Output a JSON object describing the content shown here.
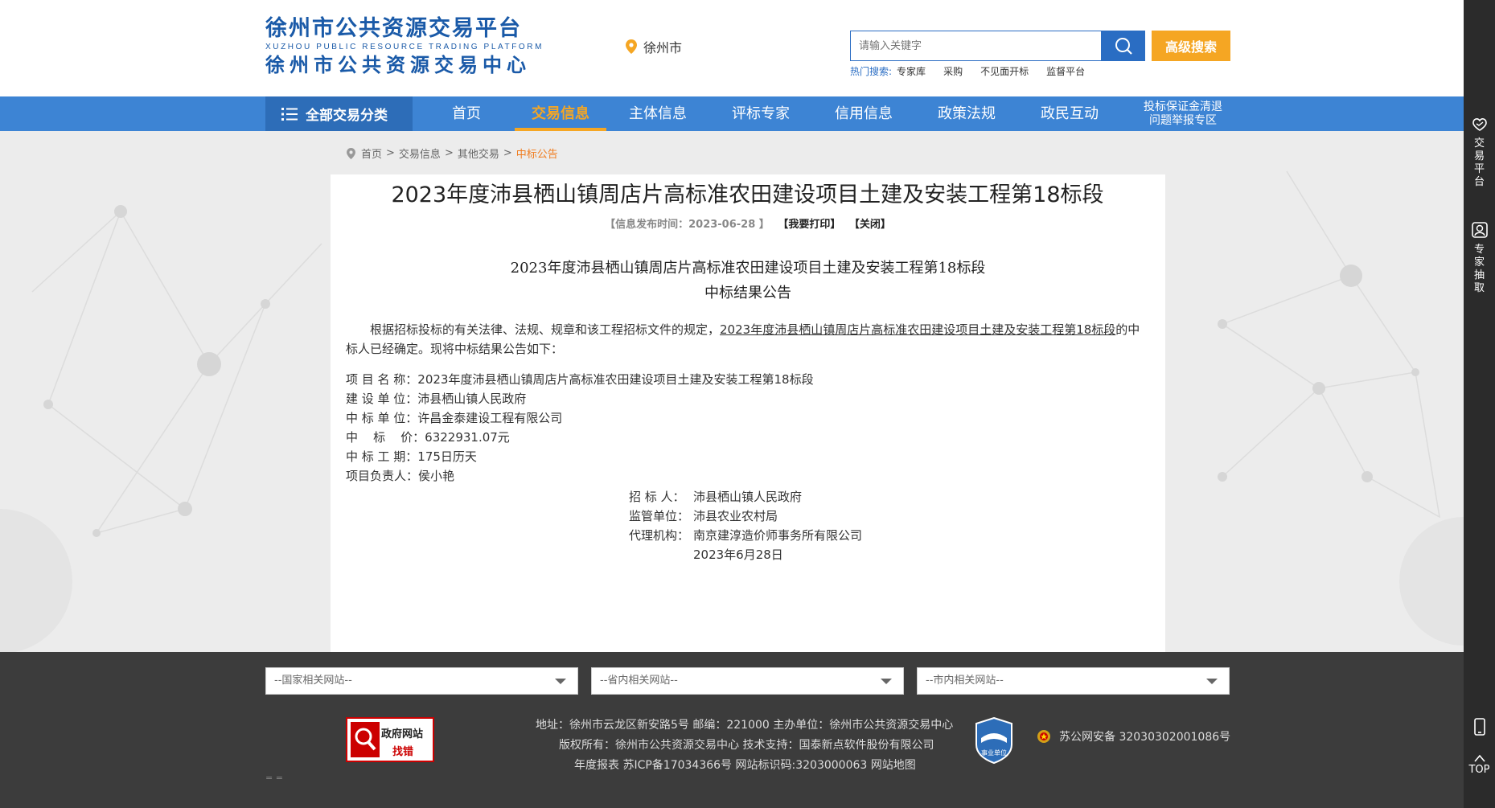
{
  "header": {
    "logo_line1": "徐州市公共资源交易平台",
    "logo_line2": "XUZHOU PUBLIC RESOURCE TRADING PLATFORM",
    "logo_line3": "徐州市公共资源交易中心",
    "city": "徐州市",
    "search_placeholder": "请输入关键字",
    "advanced_search": "高级搜索",
    "hot_label": "热门搜索:",
    "hot_items": [
      "专家库",
      "采购",
      "不见面开标",
      "监督平台"
    ]
  },
  "nav": {
    "all": "全部交易分类",
    "items": [
      "首页",
      "交易信息",
      "主体信息",
      "评标专家",
      "信用信息",
      "政策法规",
      "政民互动"
    ],
    "special_line1": "投标保证金清退",
    "special_line2": "问题举报专区"
  },
  "breadcrumb": [
    "首页",
    "交易信息",
    "其他交易",
    "中标公告"
  ],
  "article": {
    "title": "2023年度沛县栖山镇周店片高标准农田建设项目土建及安装工程第18标段",
    "publish": "【信息发布时间：2023-06-28 】",
    "print": "【我要打印】",
    "close": "【关闭】",
    "doc_title_1": "2023年度沛县栖山镇周店片高标准农田建设项目土建及安装工程第18标段",
    "doc_title_2": "中标结果公告",
    "para_start": "根据招标投标的有关法律、法规、规章和该工程招标文件的规定，",
    "para_link": "2023年度沛县栖山镇周店片高标准农田建设项目土建及安装工程第18标段",
    "para_end": "的中标人已经确定。现将中标结果公告如下：",
    "fields": [
      "项 目 名 称：2023年度沛县栖山镇周店片高标准农田建设项目土建及安装工程第18标段",
      "建 设 单 位：沛县栖山镇人民政府",
      "中 标 单 位：许昌金泰建设工程有限公司",
      "中    标    价：6322931.07元",
      "中 标 工 期：175日历天",
      "项目负责人：侯小艳"
    ],
    "sign": [
      {
        "k": "招 标 人：",
        "v": "沛县栖山镇人民政府"
      },
      {
        "k": "监管单位：",
        "v": "沛县农业农村局"
      },
      {
        "k": "代理机构：",
        "v": "南京建淳造价师事务所有限公司"
      },
      {
        "k": "",
        "v": "2023年6月28日"
      }
    ]
  },
  "footer": {
    "select_national": "--国家相关网站--",
    "select_province": "--省内相关网站--",
    "select_city": "--市内相关网站--",
    "gov_badge_top": "政府网站",
    "gov_badge_bottom": "找错",
    "line1": "地址：徐州市云龙区新安路5号    邮编：221000    主办单位：徐州市公共资源交易中心",
    "line2": "版权所有：徐州市公共资源交易中心    技术支持：国泰新点软件股份有限公司",
    "line3": "年度报表    苏ICP备17034366号    网站标识码:3203000063    网站地图",
    "police": "苏公网安备 32030302001086号",
    "seal_text": "事业单位",
    "dots": "= ="
  },
  "sidebar": {
    "trade_platform": "交易平台",
    "expert_draw": "专家抽取",
    "top": "TOP"
  },
  "colors": {
    "brand_blue": "#1a5aa8",
    "nav_blue": "#3d84d4",
    "accent_orange": "#f5a623",
    "footer_dark": "#3c3c3c"
  }
}
